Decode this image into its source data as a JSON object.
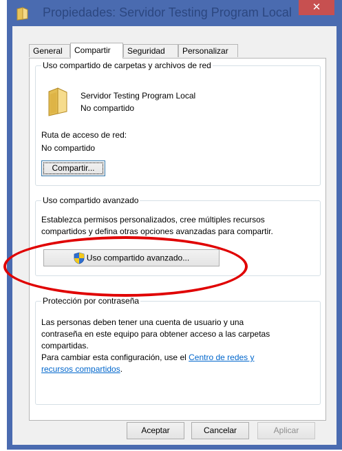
{
  "window": {
    "title": "Propiedades: Servidor Testing Program Local",
    "close_glyph": "✕"
  },
  "tabs": [
    {
      "label": "General",
      "active": false
    },
    {
      "label": "Compartir",
      "active": true
    },
    {
      "label": "Seguridad",
      "active": false
    },
    {
      "label": "Personalizar",
      "active": false
    }
  ],
  "network_sharing": {
    "legend": "Uso compartido de carpetas y archivos de red",
    "folder_name": "Servidor Testing Program Local",
    "folder_status": "No compartido",
    "path_label": "Ruta de acceso de red:",
    "path_value": "No compartido",
    "share_button": "Compartir..."
  },
  "advanced_sharing": {
    "legend": "Uso compartido avanzado",
    "description_line1": "Establezca permisos personalizados, cree múltiples recursos",
    "description_line2": "compartidos y defina otras opciones avanzadas para compartir.",
    "button": "Uso compartido avanzado..."
  },
  "password_protection": {
    "legend": "Protección por contraseña",
    "line1": "Las personas deben tener una cuenta de usuario y una",
    "line2": "contraseña en este equipo para obtener acceso a las carpetas",
    "line3": "compartidas.",
    "line4": "Para cambiar esta configuración, use el",
    "link_part1": "Centro de redes y",
    "link_part2": "recursos compartidos",
    "line_end": "."
  },
  "footer": {
    "ok": "Aceptar",
    "cancel": "Cancelar",
    "apply": "Aplicar"
  },
  "colors": {
    "title_bar": "#4a6bb0",
    "close_button": "#c75050",
    "link": "#0066cc",
    "annotation": "#e00000"
  },
  "icons": {
    "title": "folder-icon",
    "folder": "folder-icon",
    "shield": "uac-shield-icon"
  }
}
